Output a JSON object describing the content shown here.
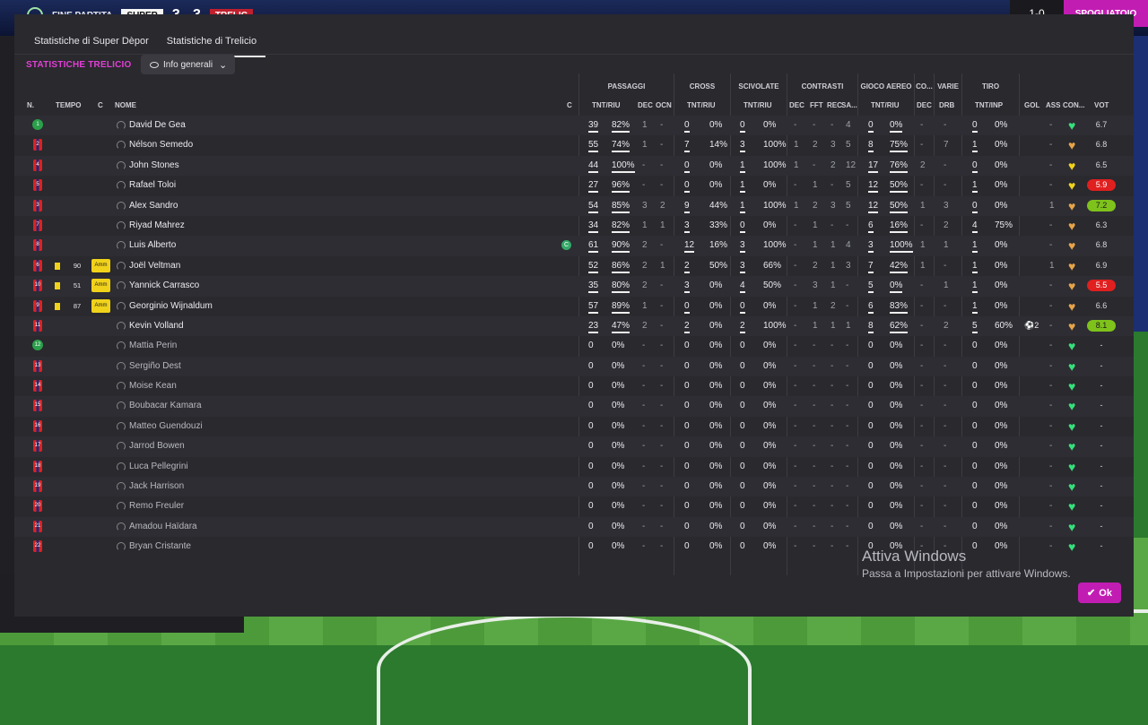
{
  "scorebar": {
    "label": "FINE PARTITA",
    "home": "SUPER",
    "score": "3 - 3",
    "away": "TRELIC",
    "counter": "1-0",
    "right_button": "SPOGLIATOIO"
  },
  "tabs": [
    {
      "label": "Statistiche di Super Dèpor"
    },
    {
      "label": "Statistiche di Trelicio"
    }
  ],
  "section_title": "STATISTICHE TRELICIO",
  "dropdown": {
    "label": "Info generali"
  },
  "groups": {
    "passaggi": "PASSAGGI",
    "cross": "CROSS",
    "scivolate": "SCIVOLATE",
    "contrasti": "CONTRASTI",
    "gioco_aereo": "GIOCO AEREO",
    "co": "CO...",
    "varie": "VARIE",
    "tiro": "TIRO"
  },
  "columns": {
    "n": "N.",
    "tempo": "TEMPO",
    "c": "C",
    "nome": "NOME",
    "c2": "C",
    "tnt_riu": "TNT/RIU",
    "dec": "DEC",
    "ocn": "OCN",
    "fft": "FFT",
    "rec": "REC",
    "sa": "SA...",
    "drb": "DRB",
    "tnt_unp": "TNT/INP",
    "gol": "GOL",
    "ass": "ASS",
    "con": "CON...",
    "vot": "VOT"
  },
  "players": [
    {
      "n": "1",
      "type": "gk",
      "name": "David De Gea",
      "sub": false,
      "card": "",
      "tempo": "",
      "amm": "",
      "cap": false,
      "pass": [
        "39",
        "82%"
      ],
      "pdec": "1",
      "ocn": "-",
      "cross": [
        "0",
        "0%"
      ],
      "sciv": [
        "0",
        "0%"
      ],
      "cdec": "-",
      "fft": "-",
      "rec": "-",
      "sa": "4",
      "aereo": [
        "0",
        "0%"
      ],
      "adec": "-",
      "drb": "-",
      "tiro": [
        "0",
        "0%"
      ],
      "gol": "",
      "ass": "-",
      "con": "g",
      "vot": "6.7",
      "vot_style": ""
    },
    {
      "n": "2",
      "type": "st",
      "name": "Nélson Semedo",
      "sub": false,
      "card": "",
      "tempo": "",
      "amm": "",
      "cap": false,
      "pass": [
        "55",
        "74%"
      ],
      "pdec": "1",
      "ocn": "-",
      "cross": [
        "7",
        "14%"
      ],
      "sciv": [
        "3",
        "100%"
      ],
      "cdec": "1",
      "fft": "2",
      "rec": "3",
      "sa": "5",
      "aereo": [
        "8",
        "75%"
      ],
      "adec": "-",
      "drb": "7",
      "tiro": [
        "1",
        "0%"
      ],
      "gol": "",
      "ass": "-",
      "con": "o",
      "vot": "6.8",
      "vot_style": ""
    },
    {
      "n": "4",
      "type": "st",
      "name": "John Stones",
      "sub": false,
      "card": "",
      "tempo": "",
      "amm": "",
      "cap": false,
      "pass": [
        "44",
        "100%"
      ],
      "pdec": "-",
      "ocn": "-",
      "cross": [
        "0",
        "0%"
      ],
      "sciv": [
        "1",
        "100%"
      ],
      "cdec": "1",
      "fft": "-",
      "rec": "2",
      "sa": "12",
      "aereo": [
        "17",
        "76%"
      ],
      "adec": "2",
      "drb": "-",
      "tiro": [
        "0",
        "0%"
      ],
      "gol": "",
      "ass": "-",
      "con": "y",
      "vot": "6.5",
      "vot_style": ""
    },
    {
      "n": "5",
      "type": "st",
      "name": "Rafael Toloi",
      "sub": false,
      "card": "",
      "tempo": "",
      "amm": "",
      "cap": false,
      "pass": [
        "27",
        "96%"
      ],
      "pdec": "-",
      "ocn": "-",
      "cross": [
        "0",
        "0%"
      ],
      "sciv": [
        "1",
        "0%"
      ],
      "cdec": "-",
      "fft": "1",
      "rec": "-",
      "sa": "5",
      "aereo": [
        "12",
        "50%"
      ],
      "adec": "-",
      "drb": "-",
      "tiro": [
        "1",
        "0%"
      ],
      "gol": "",
      "ass": "-",
      "con": "y",
      "vot": "5.9",
      "vot_style": "red"
    },
    {
      "n": "3",
      "type": "st",
      "name": "Alex Sandro",
      "sub": false,
      "card": "",
      "tempo": "",
      "amm": "",
      "cap": false,
      "pass": [
        "54",
        "85%"
      ],
      "pdec": "3",
      "ocn": "2",
      "cross": [
        "9",
        "44%"
      ],
      "sciv": [
        "1",
        "100%"
      ],
      "cdec": "1",
      "fft": "2",
      "rec": "3",
      "sa": "5",
      "aereo": [
        "12",
        "50%"
      ],
      "adec": "1",
      "drb": "3",
      "tiro": [
        "0",
        "0%"
      ],
      "gol": "",
      "ass": "1",
      "con": "o",
      "vot": "7.2",
      "vot_style": "grn"
    },
    {
      "n": "7",
      "type": "st",
      "name": "Riyad Mahrez",
      "sub": false,
      "card": "",
      "tempo": "",
      "amm": "",
      "cap": false,
      "pass": [
        "34",
        "82%"
      ],
      "pdec": "1",
      "ocn": "1",
      "cross": [
        "3",
        "33%"
      ],
      "sciv": [
        "0",
        "0%"
      ],
      "cdec": "-",
      "fft": "1",
      "rec": "-",
      "sa": "-",
      "aereo": [
        "6",
        "16%"
      ],
      "adec": "-",
      "drb": "2",
      "tiro": [
        "4",
        "75%"
      ],
      "gol": "",
      "ass": "-",
      "con": "o",
      "vot": "6.3",
      "vot_style": ""
    },
    {
      "n": "8",
      "type": "st",
      "name": "Luis Alberto",
      "sub": false,
      "card": "",
      "tempo": "",
      "amm": "",
      "cap": true,
      "pass": [
        "61",
        "90%"
      ],
      "pdec": "2",
      "ocn": "-",
      "cross": [
        "12",
        "16%"
      ],
      "sciv": [
        "3",
        "100%"
      ],
      "cdec": "-",
      "fft": "1",
      "rec": "1",
      "sa": "4",
      "aereo": [
        "3",
        "100%"
      ],
      "adec": "1",
      "drb": "1",
      "tiro": [
        "1",
        "0%"
      ],
      "gol": "",
      "ass": "-",
      "con": "o",
      "vot": "6.8",
      "vot_style": ""
    },
    {
      "n": "6",
      "type": "st",
      "name": "Joël Veltman",
      "sub": false,
      "card": "yellow",
      "tempo": "90",
      "amm": "Amm",
      "cap": false,
      "pass": [
        "52",
        "86%"
      ],
      "pdec": "2",
      "ocn": "1",
      "cross": [
        "2",
        "50%"
      ],
      "sciv": [
        "3",
        "66%"
      ],
      "cdec": "-",
      "fft": "2",
      "rec": "1",
      "sa": "3",
      "aereo": [
        "7",
        "42%"
      ],
      "adec": "1",
      "drb": "-",
      "tiro": [
        "1",
        "0%"
      ],
      "gol": "",
      "ass": "1",
      "con": "o",
      "vot": "6.9",
      "vot_style": ""
    },
    {
      "n": "10",
      "type": "st",
      "name": "Yannick Carrasco",
      "sub": false,
      "card": "yellow",
      "tempo": "51",
      "amm": "Amm",
      "cap": false,
      "pass": [
        "35",
        "80%"
      ],
      "pdec": "2",
      "ocn": "-",
      "cross": [
        "3",
        "0%"
      ],
      "sciv": [
        "4",
        "50%"
      ],
      "cdec": "-",
      "fft": "3",
      "rec": "1",
      "sa": "-",
      "aereo": [
        "5",
        "0%"
      ],
      "adec": "-",
      "drb": "1",
      "tiro": [
        "1",
        "0%"
      ],
      "gol": "",
      "ass": "-",
      "con": "o",
      "vot": "5.5",
      "vot_style": "red"
    },
    {
      "n": "9",
      "type": "st",
      "name": "Georginio Wijnaldum",
      "sub": false,
      "card": "yellow",
      "tempo": "87",
      "amm": "Amm",
      "cap": false,
      "pass": [
        "57",
        "89%"
      ],
      "pdec": "1",
      "ocn": "-",
      "cross": [
        "0",
        "0%"
      ],
      "sciv": [
        "0",
        "0%"
      ],
      "cdec": "-",
      "fft": "1",
      "rec": "2",
      "sa": "-",
      "aereo": [
        "6",
        "83%"
      ],
      "adec": "-",
      "drb": "-",
      "tiro": [
        "1",
        "0%"
      ],
      "gol": "",
      "ass": "-",
      "con": "o",
      "vot": "6.6",
      "vot_style": ""
    },
    {
      "n": "11",
      "type": "st",
      "name": "Kevin Volland",
      "sub": false,
      "card": "",
      "tempo": "",
      "amm": "",
      "cap": false,
      "pass": [
        "23",
        "47%"
      ],
      "pdec": "2",
      "ocn": "-",
      "cross": [
        "2",
        "0%"
      ],
      "sciv": [
        "2",
        "100%"
      ],
      "cdec": "-",
      "fft": "1",
      "rec": "1",
      "sa": "1",
      "aereo": [
        "8",
        "62%"
      ],
      "adec": "-",
      "drb": "2",
      "tiro": [
        "5",
        "60%"
      ],
      "gol": "⚽2",
      "ass": "-",
      "con": "o",
      "vot": "8.1",
      "vot_style": "grn"
    },
    {
      "n": "12",
      "type": "gk",
      "name": "Mattia Perin",
      "sub": true,
      "card": "",
      "tempo": "",
      "amm": "",
      "cap": false,
      "pass": [
        "0",
        "0%"
      ],
      "pdec": "-",
      "ocn": "-",
      "cross": [
        "0",
        "0%"
      ],
      "sciv": [
        "0",
        "0%"
      ],
      "cdec": "-",
      "fft": "-",
      "rec": "-",
      "sa": "-",
      "aereo": [
        "0",
        "0%"
      ],
      "adec": "-",
      "drb": "-",
      "tiro": [
        "0",
        "0%"
      ],
      "gol": "",
      "ass": "-",
      "con": "g",
      "vot": "-",
      "vot_style": ""
    },
    {
      "n": "13",
      "type": "st",
      "name": "Sergiño Dest",
      "sub": true,
      "card": "",
      "tempo": "",
      "amm": "",
      "cap": false,
      "pass": [
        "0",
        "0%"
      ],
      "pdec": "-",
      "ocn": "-",
      "cross": [
        "0",
        "0%"
      ],
      "sciv": [
        "0",
        "0%"
      ],
      "cdec": "-",
      "fft": "-",
      "rec": "-",
      "sa": "-",
      "aereo": [
        "0",
        "0%"
      ],
      "adec": "-",
      "drb": "-",
      "tiro": [
        "0",
        "0%"
      ],
      "gol": "",
      "ass": "-",
      "con": "g",
      "vot": "-",
      "vot_style": ""
    },
    {
      "n": "14",
      "type": "st",
      "name": "Moise Kean",
      "sub": true,
      "card": "",
      "tempo": "",
      "amm": "",
      "cap": false,
      "pass": [
        "0",
        "0%"
      ],
      "pdec": "-",
      "ocn": "-",
      "cross": [
        "0",
        "0%"
      ],
      "sciv": [
        "0",
        "0%"
      ],
      "cdec": "-",
      "fft": "-",
      "rec": "-",
      "sa": "-",
      "aereo": [
        "0",
        "0%"
      ],
      "adec": "-",
      "drb": "-",
      "tiro": [
        "0",
        "0%"
      ],
      "gol": "",
      "ass": "-",
      "con": "g",
      "vot": "-",
      "vot_style": ""
    },
    {
      "n": "15",
      "type": "st",
      "name": "Boubacar Kamara",
      "sub": true,
      "card": "",
      "tempo": "",
      "amm": "",
      "cap": false,
      "pass": [
        "0",
        "0%"
      ],
      "pdec": "-",
      "ocn": "-",
      "cross": [
        "0",
        "0%"
      ],
      "sciv": [
        "0",
        "0%"
      ],
      "cdec": "-",
      "fft": "-",
      "rec": "-",
      "sa": "-",
      "aereo": [
        "0",
        "0%"
      ],
      "adec": "-",
      "drb": "-",
      "tiro": [
        "0",
        "0%"
      ],
      "gol": "",
      "ass": "-",
      "con": "g",
      "vot": "-",
      "vot_style": ""
    },
    {
      "n": "16",
      "type": "st",
      "name": "Matteo Guendouzi",
      "sub": true,
      "card": "",
      "tempo": "",
      "amm": "",
      "cap": false,
      "pass": [
        "0",
        "0%"
      ],
      "pdec": "-",
      "ocn": "-",
      "cross": [
        "0",
        "0%"
      ],
      "sciv": [
        "0",
        "0%"
      ],
      "cdec": "-",
      "fft": "-",
      "rec": "-",
      "sa": "-",
      "aereo": [
        "0",
        "0%"
      ],
      "adec": "-",
      "drb": "-",
      "tiro": [
        "0",
        "0%"
      ],
      "gol": "",
      "ass": "-",
      "con": "g",
      "vot": "-",
      "vot_style": ""
    },
    {
      "n": "17",
      "type": "st",
      "name": "Jarrod Bowen",
      "sub": true,
      "card": "",
      "tempo": "",
      "amm": "",
      "cap": false,
      "pass": [
        "0",
        "0%"
      ],
      "pdec": "-",
      "ocn": "-",
      "cross": [
        "0",
        "0%"
      ],
      "sciv": [
        "0",
        "0%"
      ],
      "cdec": "-",
      "fft": "-",
      "rec": "-",
      "sa": "-",
      "aereo": [
        "0",
        "0%"
      ],
      "adec": "-",
      "drb": "-",
      "tiro": [
        "0",
        "0%"
      ],
      "gol": "",
      "ass": "-",
      "con": "g",
      "vot": "-",
      "vot_style": ""
    },
    {
      "n": "18",
      "type": "st",
      "name": "Luca Pellegrini",
      "sub": true,
      "card": "",
      "tempo": "",
      "amm": "",
      "cap": false,
      "pass": [
        "0",
        "0%"
      ],
      "pdec": "-",
      "ocn": "-",
      "cross": [
        "0",
        "0%"
      ],
      "sciv": [
        "0",
        "0%"
      ],
      "cdec": "-",
      "fft": "-",
      "rec": "-",
      "sa": "-",
      "aereo": [
        "0",
        "0%"
      ],
      "adec": "-",
      "drb": "-",
      "tiro": [
        "0",
        "0%"
      ],
      "gol": "",
      "ass": "-",
      "con": "g",
      "vot": "-",
      "vot_style": ""
    },
    {
      "n": "19",
      "type": "st",
      "name": "Jack Harrison",
      "sub": true,
      "card": "",
      "tempo": "",
      "amm": "",
      "cap": false,
      "pass": [
        "0",
        "0%"
      ],
      "pdec": "-",
      "ocn": "-",
      "cross": [
        "0",
        "0%"
      ],
      "sciv": [
        "0",
        "0%"
      ],
      "cdec": "-",
      "fft": "-",
      "rec": "-",
      "sa": "-",
      "aereo": [
        "0",
        "0%"
      ],
      "adec": "-",
      "drb": "-",
      "tiro": [
        "0",
        "0%"
      ],
      "gol": "",
      "ass": "-",
      "con": "g",
      "vot": "-",
      "vot_style": ""
    },
    {
      "n": "20",
      "type": "st",
      "name": "Remo Freuler",
      "sub": true,
      "card": "",
      "tempo": "",
      "amm": "",
      "cap": false,
      "pass": [
        "0",
        "0%"
      ],
      "pdec": "-",
      "ocn": "-",
      "cross": [
        "0",
        "0%"
      ],
      "sciv": [
        "0",
        "0%"
      ],
      "cdec": "-",
      "fft": "-",
      "rec": "-",
      "sa": "-",
      "aereo": [
        "0",
        "0%"
      ],
      "adec": "-",
      "drb": "-",
      "tiro": [
        "0",
        "0%"
      ],
      "gol": "",
      "ass": "-",
      "con": "g",
      "vot": "-",
      "vot_style": ""
    },
    {
      "n": "21",
      "type": "st",
      "name": "Amadou Haïdara",
      "sub": true,
      "card": "",
      "tempo": "",
      "amm": "",
      "cap": false,
      "pass": [
        "0",
        "0%"
      ],
      "pdec": "-",
      "ocn": "-",
      "cross": [
        "0",
        "0%"
      ],
      "sciv": [
        "0",
        "0%"
      ],
      "cdec": "-",
      "fft": "-",
      "rec": "-",
      "sa": "-",
      "aereo": [
        "0",
        "0%"
      ],
      "adec": "-",
      "drb": "-",
      "tiro": [
        "0",
        "0%"
      ],
      "gol": "",
      "ass": "-",
      "con": "g",
      "vot": "-",
      "vot_style": ""
    },
    {
      "n": "22",
      "type": "st",
      "name": "Bryan Cristante",
      "sub": true,
      "card": "",
      "tempo": "",
      "amm": "",
      "cap": false,
      "pass": [
        "0",
        "0%"
      ],
      "pdec": "-",
      "ocn": "-",
      "cross": [
        "0",
        "0%"
      ],
      "sciv": [
        "0",
        "0%"
      ],
      "cdec": "-",
      "fft": "-",
      "rec": "-",
      "sa": "-",
      "aereo": [
        "0",
        "0%"
      ],
      "adec": "-",
      "drb": "-",
      "tiro": [
        "0",
        "0%"
      ],
      "gol": "",
      "ass": "-",
      "con": "g",
      "vot": "-",
      "vot_style": ""
    }
  ],
  "watermark": {
    "line1": "Attiva Windows",
    "line2": "Passa a Impostazioni per attivare Windows."
  },
  "ok_button": {
    "label": "Ok"
  }
}
